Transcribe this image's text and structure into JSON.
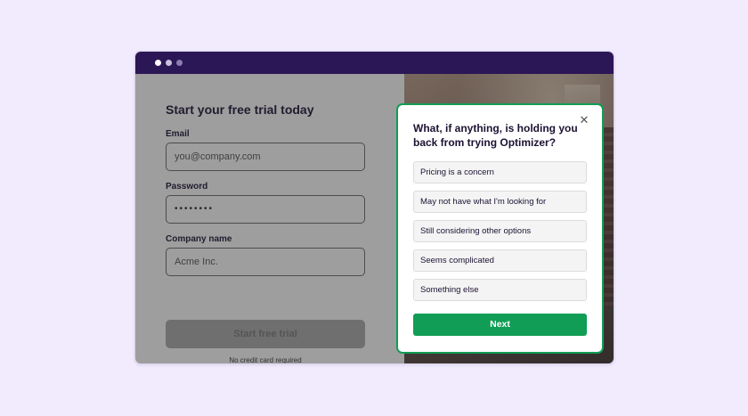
{
  "form": {
    "title": "Start your free trial today",
    "email_label": "Email",
    "email_placeholder": "you@company.com",
    "password_label": "Password",
    "password_value": "••••••••",
    "company_label": "Company name",
    "company_placeholder": "Acme Inc.",
    "submit_label": "Start free trial",
    "note": "No credit card required"
  },
  "survey": {
    "question": "What, if anything, is holding you back from trying Optimizer?",
    "close_icon": "close-icon",
    "options": [
      "Pricing is a concern",
      "May not have what I'm looking for",
      "Still considering other options",
      "Seems complicated",
      "Something else"
    ],
    "next_label": "Next",
    "accent_color": "#119d55"
  },
  "window": {
    "titlebar_color": "#2b1656"
  }
}
